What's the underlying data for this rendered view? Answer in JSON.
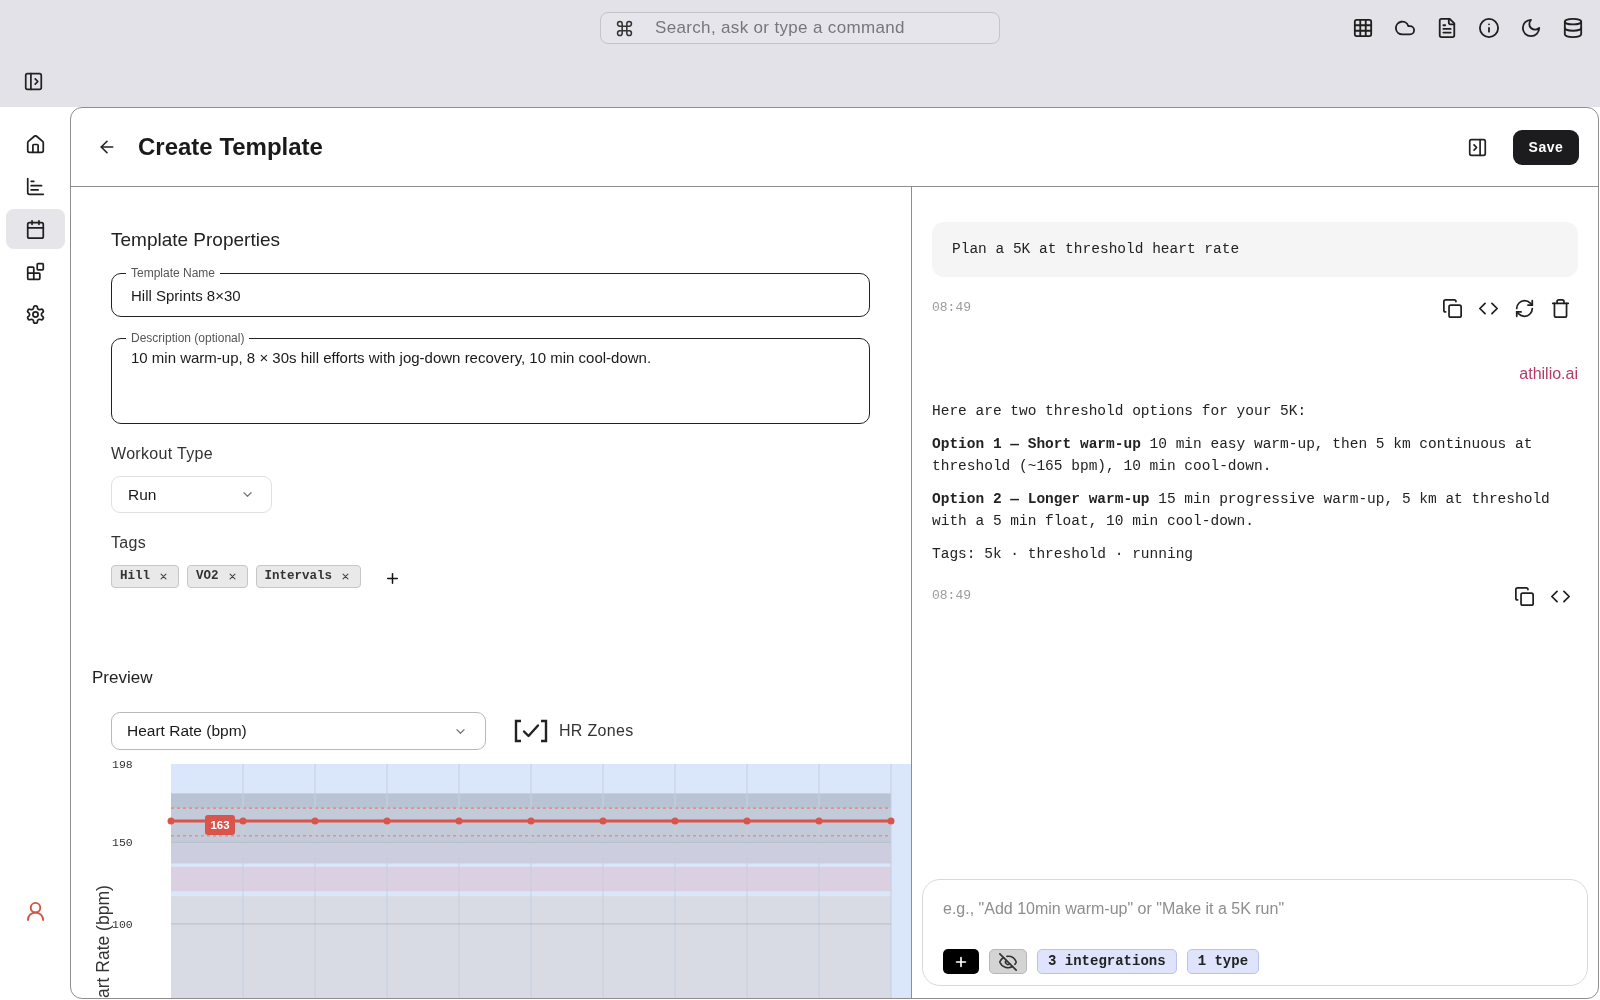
{
  "top_bar": {
    "search": {
      "placeholder": "Search, ask or type a command"
    }
  },
  "sidebar": {
    "items": [
      {
        "selected": false
      },
      {
        "selected": false
      },
      {
        "selected": true
      },
      {
        "selected": false
      },
      {
        "selected": false
      }
    ]
  },
  "header": {
    "title": "Create Template",
    "save_button": "Save"
  },
  "form": {
    "heading": "Template Properties",
    "template_name": {
      "label": "Template Name",
      "value": "Hill Sprints 8×30"
    },
    "description": {
      "label": "Description (optional)",
      "value": "10 min warm-up, 8 × 30s hill efforts with jog-down recovery, 10 min cool-down."
    },
    "workout_type": {
      "label": "Workout Type",
      "value": "Run"
    },
    "tags": {
      "label": "Tags",
      "items": [
        "Hill",
        "VO2",
        "Intervals"
      ]
    }
  },
  "preview": {
    "heading": "Preview",
    "metric_select": {
      "value": "Heart Rate (bpm)"
    },
    "hr_zones": {
      "label": "HR Zones",
      "checked": true
    },
    "chart_data": {
      "type": "line",
      "ylabel": "art Rate (bpm)",
      "ylim": [
        54,
        198
      ],
      "yticks": [
        198,
        150,
        100
      ],
      "grid": true,
      "series": [
        {
          "color": "#d9544a",
          "marker": "circle",
          "values": [
            163,
            163,
            163,
            163,
            163,
            163,
            163,
            163,
            163,
            163,
            163
          ]
        }
      ],
      "annotations": [
        {
          "text": "163",
          "y": 163
        }
      ]
    }
  },
  "chat": {
    "messages": [
      {
        "kind": "user",
        "text": "Plan a 5K at threshold heart rate",
        "time": "08:49"
      },
      {
        "kind": "assistant",
        "author": "athilio.ai",
        "paragraphs": [
          "Here are two threshold options for your 5K:",
          "**Option 1 — Short warm-up** 10 min easy warm-up, then 5 km continuous at threshold (~165 bpm), 10 min cool-down.",
          "**Option 2 — Longer warm-up** 15 min progressive warm-up, 5 km at threshold with a 5 min float, 10 min cool-down.",
          "Tags: 5k · threshold · running"
        ],
        "time": "08:49"
      }
    ],
    "composer": {
      "placeholder": "e.g., \"Add 10min warm-up\" or \"Make it a 5K run\"",
      "chips": [
        "3 integrations",
        "1 type"
      ]
    }
  }
}
